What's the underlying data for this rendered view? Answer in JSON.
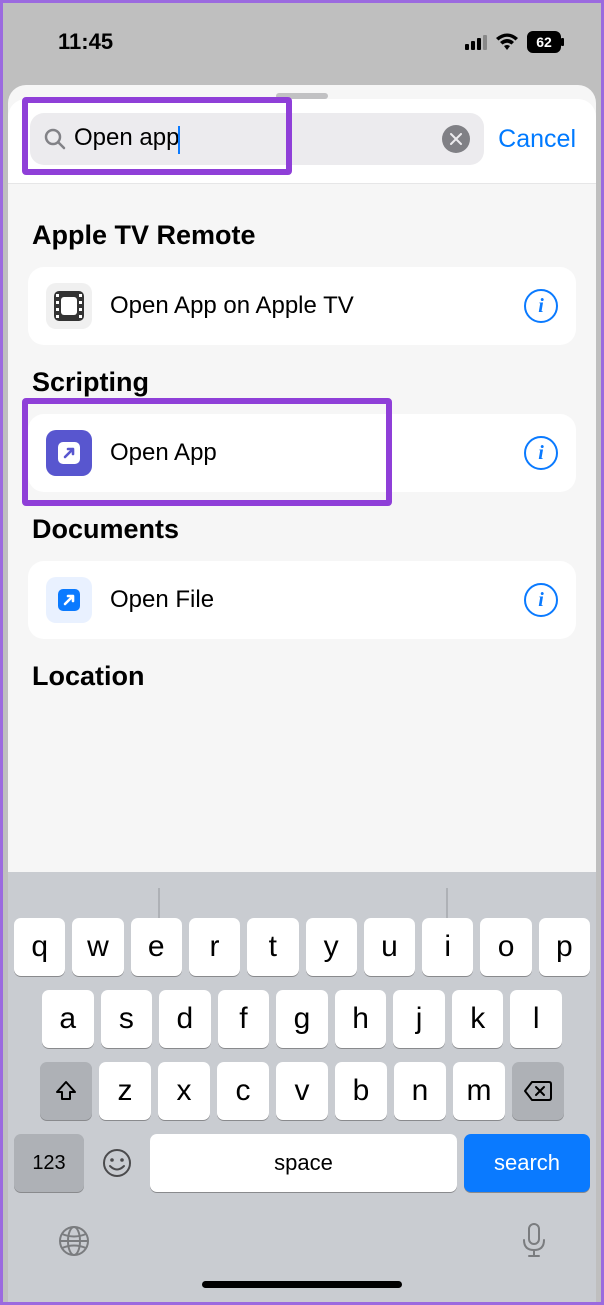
{
  "status": {
    "time": "11:45",
    "battery": "62"
  },
  "search": {
    "value": "Open app",
    "cancel": "Cancel"
  },
  "sections": {
    "appletv": {
      "title": "Apple TV Remote",
      "action": "Open App on Apple TV"
    },
    "scripting": {
      "title": "Scripting",
      "action": "Open App"
    },
    "documents": {
      "title": "Documents",
      "action": "Open File"
    },
    "location": {
      "title": "Location"
    }
  },
  "keyboard": {
    "row1": [
      "q",
      "w",
      "e",
      "r",
      "t",
      "y",
      "u",
      "i",
      "o",
      "p"
    ],
    "row2": [
      "a",
      "s",
      "d",
      "f",
      "g",
      "h",
      "j",
      "k",
      "l"
    ],
    "row3": [
      "z",
      "x",
      "c",
      "v",
      "b",
      "n",
      "m"
    ],
    "num": "123",
    "space": "space",
    "search": "search"
  }
}
